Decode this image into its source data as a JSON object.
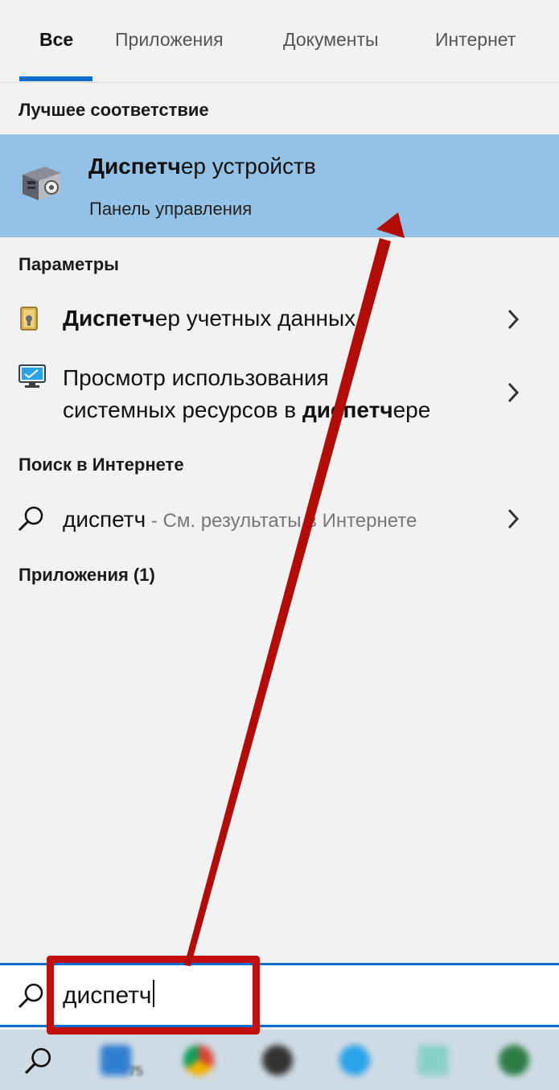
{
  "tabs": [
    {
      "label": "Все",
      "active": true
    },
    {
      "label": "Приложения",
      "active": false
    },
    {
      "label": "Документы",
      "active": false
    },
    {
      "label": "Интернет",
      "active": false
    }
  ],
  "best_match": {
    "heading": "Лучшее соответствие",
    "title_bold": "Диспетч",
    "title_rest": "ер устройств",
    "subtitle": "Панель управления",
    "icon": "device-manager-icon"
  },
  "settings": {
    "heading": "Параметры",
    "items": [
      {
        "bold": "Диспетч",
        "rest": "ер учетных данных",
        "icon": "credential-manager-icon"
      },
      {
        "line1": "Просмотр использования",
        "line2_pre": "системных ресурсов в ",
        "line2_bold": "диспетч",
        "line2_post": "ере",
        "icon": "monitor-icon"
      }
    ]
  },
  "web": {
    "heading": "Поиск в Интернете",
    "query": "диспетч",
    "suffix": " - См. результаты в Интернете"
  },
  "apps": {
    "heading": "Приложения (1)"
  },
  "search": {
    "value": "диспетч"
  },
  "taskbar": {
    "apps": [
      "mail-icon",
      "chrome-icon",
      "app-icon",
      "telegram-icon",
      "app-icon",
      "app-icon"
    ],
    "mail_badge": "75"
  },
  "colors": {
    "accent": "#0a6fd1",
    "highlight": "#93c2e6",
    "annotation": "#c1100b"
  }
}
